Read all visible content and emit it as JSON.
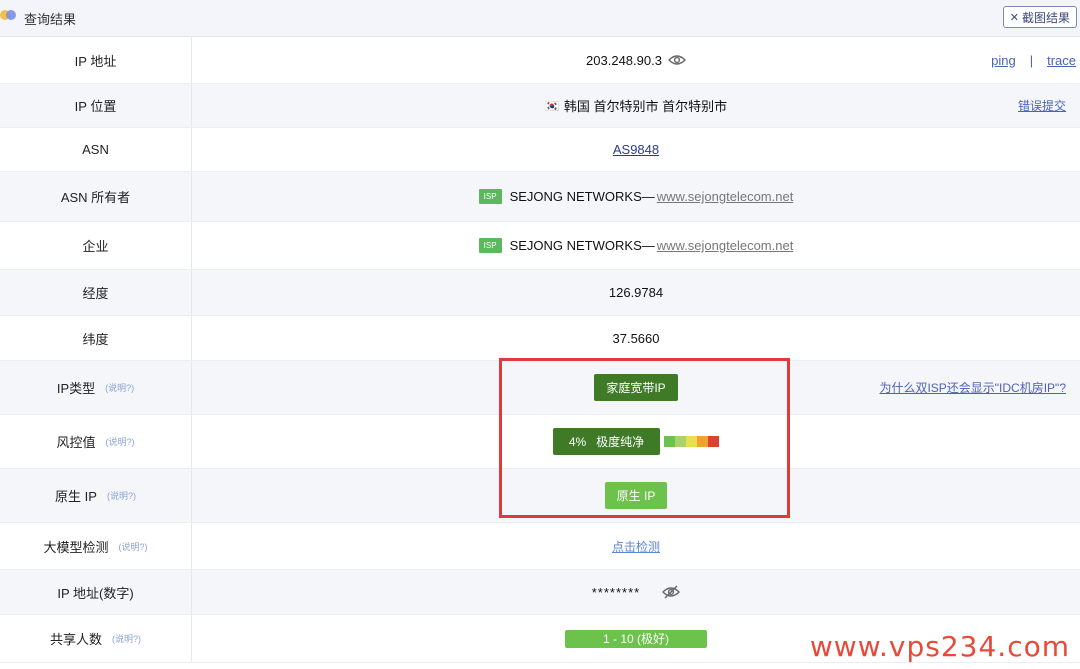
{
  "header": {
    "title": "查询结果",
    "screenshot_button": "截图结果"
  },
  "rows": {
    "ip": {
      "label": "IP 地址",
      "value": "203.248.90.3",
      "ping": "ping",
      "sep": "|",
      "trace": "trace"
    },
    "location": {
      "label": "IP 位置",
      "flag": "🇰🇷",
      "value": "韩国 首尔特别市 首尔特别市",
      "report": "错误提交"
    },
    "asn": {
      "label": "ASN",
      "value": "AS9848"
    },
    "asn_owner": {
      "label": "ASN 所有者",
      "badge": "ISP",
      "name": "SEJONG NETWORKS",
      "dash": "—",
      "site": "www.sejongtelecom.net"
    },
    "company": {
      "label": "企业",
      "badge": "ISP",
      "name": "SEJONG NETWORKS",
      "dash": "—",
      "site": "www.sejongtelecom.net"
    },
    "longitude": {
      "label": "经度",
      "value": "126.9784"
    },
    "latitude": {
      "label": "纬度",
      "value": "37.5660"
    },
    "ip_type": {
      "label": "IP类型",
      "help": "(说明?)",
      "value": "家庭宽带IP",
      "note": "为什么双ISP还会显示\"IDC机房IP\"?"
    },
    "risk": {
      "label": "风控值",
      "help": "(说明?)",
      "percent": "4%",
      "desc": "极度纯净",
      "bar_colors": [
        "#6cc24a",
        "#a8d36a",
        "#e6df4f",
        "#f0a330",
        "#e0402f"
      ]
    },
    "native": {
      "label": "原生 IP",
      "help": "(说明?)",
      "value": "原生 IP"
    },
    "llm": {
      "label": "大模型检测",
      "help": "(说明?)",
      "value": "点击检测"
    },
    "ip_numeric": {
      "label": "IP 地址(数字)",
      "value": "********"
    },
    "shared": {
      "label": "共享人数",
      "help": "(说明?)",
      "value": "1 - 10 (极好)"
    }
  },
  "watermark": "www.vps234.com",
  "colors": {
    "accent_dark_green": "#3f7b27",
    "accent_light_green": "#6cc24a",
    "highlight_red": "#e03a3a",
    "link_blue": "#4a63b8"
  }
}
